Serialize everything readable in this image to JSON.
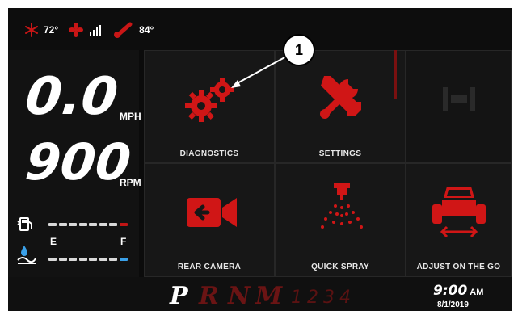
{
  "status": {
    "snow_temp": "72°",
    "air_temp": "84°",
    "icons": [
      "snowflake-icon",
      "fan-icon",
      "signal-bars-icon",
      "thermometer-icon"
    ]
  },
  "gauges": {
    "speed_value": "0.0",
    "speed_unit": "MPH",
    "rpm_value": "900",
    "rpm_unit": "RPM",
    "fuel_level": 0.85,
    "def_level": 1.0,
    "empty_label": "E",
    "full_label": "F"
  },
  "tiles": {
    "diagnostics": "DIAGNOSTICS",
    "settings": "SETTINGS",
    "rear_camera": "REAR CAMERA",
    "quick_spray": "QUICK SPRAY",
    "adjust_on_the_go": "ADJUST ON THE GO"
  },
  "gear_selector": {
    "gears": [
      "P",
      "R",
      "N",
      "M"
    ],
    "selected": "P",
    "numbers": "1234"
  },
  "clock": {
    "time": "9:00",
    "ampm": "AM",
    "date": "8/1/2019"
  },
  "callout": {
    "number": "1"
  },
  "colors": {
    "accent_red": "#d01616",
    "dark_red": "#6a1414",
    "def_blue": "#3aa0e8",
    "fuel_red": "#c01515"
  }
}
